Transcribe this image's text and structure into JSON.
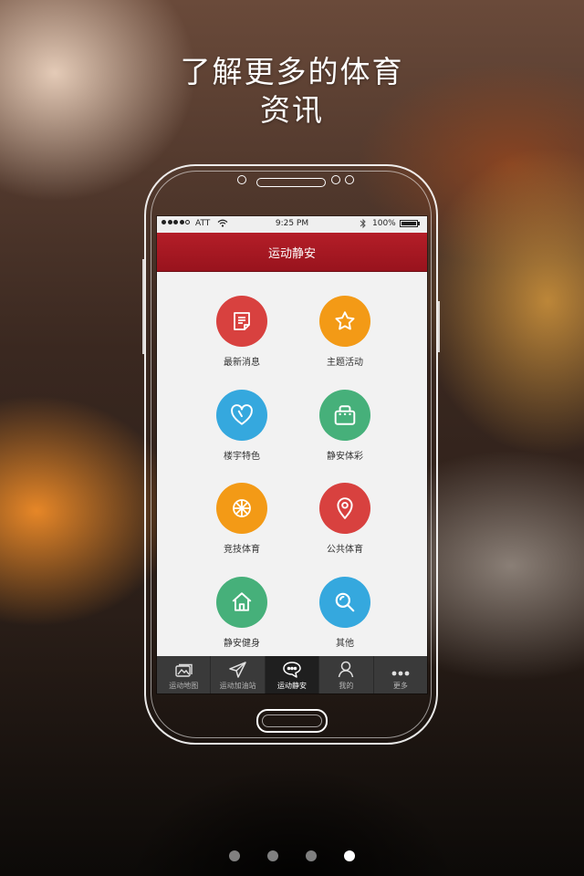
{
  "headline": {
    "line1": "了解更多的体育",
    "line2": "资讯"
  },
  "status_bar": {
    "carrier": "ATT",
    "time": "9:25 PM",
    "battery": "100%"
  },
  "nav": {
    "title": "运动静安"
  },
  "grid": [
    {
      "label": "最新消息",
      "icon": "news-icon",
      "color": "#d8413f"
    },
    {
      "label": "主题活动",
      "icon": "star-icon",
      "color": "#f39a16"
    },
    {
      "label": "楼宇特色",
      "icon": "heart-icon",
      "color": "#35a8de"
    },
    {
      "label": "静安体彩",
      "icon": "lottery-bag-icon",
      "color": "#46b07a"
    },
    {
      "label": "竞技体育",
      "icon": "basketball-icon",
      "color": "#f39a16"
    },
    {
      "label": "公共体育",
      "icon": "location-pin-icon",
      "color": "#d8413f"
    },
    {
      "label": "静安健身",
      "icon": "home-icon",
      "color": "#46b07a"
    },
    {
      "label": "其他",
      "icon": "search-icon",
      "color": "#35a8de"
    }
  ],
  "tabs": [
    {
      "label": "运动地图",
      "icon": "map-icon"
    },
    {
      "label": "运动加油站",
      "icon": "send-icon"
    },
    {
      "label": "运动静安",
      "icon": "chat-icon",
      "active": true
    },
    {
      "label": "我的",
      "icon": "user-icon"
    },
    {
      "label": "更多",
      "icon": "more-icon"
    }
  ],
  "pager": {
    "count": 4,
    "active_index": 3
  }
}
